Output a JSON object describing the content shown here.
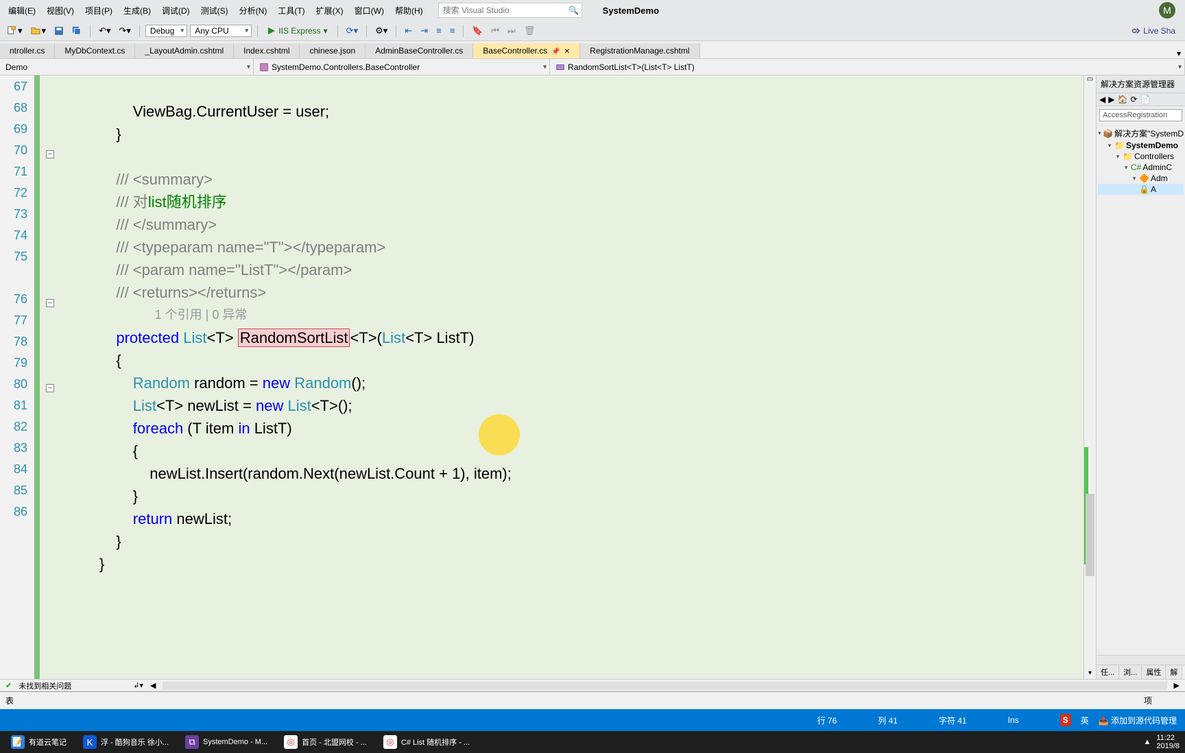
{
  "menu": {
    "items": [
      "编辑(E)",
      "视图(V)",
      "项目(P)",
      "生成(B)",
      "调试(D)",
      "测试(S)",
      "分析(N)",
      "工具(T)",
      "扩展(X)",
      "窗口(W)",
      "帮助(H)"
    ]
  },
  "search": {
    "placeholder": "搜索 Visual Studio"
  },
  "appName": "SystemDemo",
  "avatar": "M",
  "toolbar": {
    "config": "Debug",
    "platform": "Any CPU",
    "run": "IIS Express",
    "liveshare": "Live Sha"
  },
  "tabs": [
    {
      "label": "ntroller.cs"
    },
    {
      "label": "MyDbContext.cs"
    },
    {
      "label": "_LayoutAdmin.cshtml"
    },
    {
      "label": "Index.cshtml"
    },
    {
      "label": "chinese.json"
    },
    {
      "label": "AdminBaseController.cs"
    },
    {
      "label": "BaseController.cs",
      "active": true
    },
    {
      "label": "RegistrationManage.cshtml"
    }
  ],
  "nav": {
    "scope": "Demo",
    "class": "SystemDemo.Controllers.BaseController",
    "member": "RandomSortList<T>(List<T> ListT)"
  },
  "lines": [
    "67",
    "68",
    "69",
    "70",
    "71",
    "72",
    "73",
    "74",
    "75",
    "",
    "76",
    "77",
    "78",
    "79",
    "80",
    "81",
    "82",
    "83",
    "84",
    "85",
    "86"
  ],
  "codelens": "1 个引用 | 0 异常",
  "code": {
    "l67": "ViewBag.CurrentUser = user;",
    "l68": "}",
    "l70": "/// <summary>",
    "l71a": "/// 对",
    "l71b": "list",
    "l71c": "随机排序",
    "l72": "/// </summary>",
    "l73": "/// <typeparam name=\"T\"></typeparam>",
    "l74": "/// <param name=\"ListT\"></param>",
    "l75": "/// <returns></returns>",
    "l76_protected": "protected",
    "l76_list": "List",
    "l76_rand": "RandomSortList",
    "l76_list2": "List",
    "l76_param": " ListT)",
    "l77": "{",
    "l78_random": "Random",
    "l78_mid": " random = ",
    "l78_new": "new",
    "l78_sp": " ",
    "l78_Random": "Random",
    "l78_end": "();",
    "l79_list": "List",
    "l79_mid": "<T> newList = ",
    "l79_new": "new",
    "l79_sp": " ",
    "l79_list2": "List",
    "l79_end": "<T>();",
    "l80_foreach": "foreach",
    "l80_mid": " (T item ",
    "l80_in": "in",
    "l80_end": " ListT)",
    "l81": "{",
    "l82a": "newList.Insert(random.",
    "l82b": "Next",
    "l82c": "(newList.Count + 1), item);",
    "l83": "}",
    "l84_return": "return",
    "l84_end": " newList;",
    "l85": "}",
    "l86": "}"
  },
  "editorStatus": {
    "issues": "未找到相关问题"
  },
  "rightPanel": {
    "title": "解决方案资源管理器",
    "search": "AccessRegistration",
    "nodes": [
      "解决方案\"SystemD",
      "SystemDemo",
      "Controllers",
      "AdminC",
      "Adm",
      "A"
    ]
  },
  "rightBottomTabs": [
    "任...",
    "浏...",
    "属性",
    "解"
  ],
  "bottomTab": "表",
  "leftBottom": "项",
  "status": {
    "line": "行 76",
    "col": "列 41",
    "char": "字符 41",
    "ins": "Ins",
    "git": "添加到源代码管理"
  },
  "taskbar": {
    "items": [
      "有道云笔记",
      "浮 - 酷狗音乐 徐小...",
      "SystemDemo - M...",
      "首页 - 北盟网校 - ...",
      "C# List 随机排序 - ..."
    ],
    "time": "11:22",
    "date": "2019/8"
  }
}
